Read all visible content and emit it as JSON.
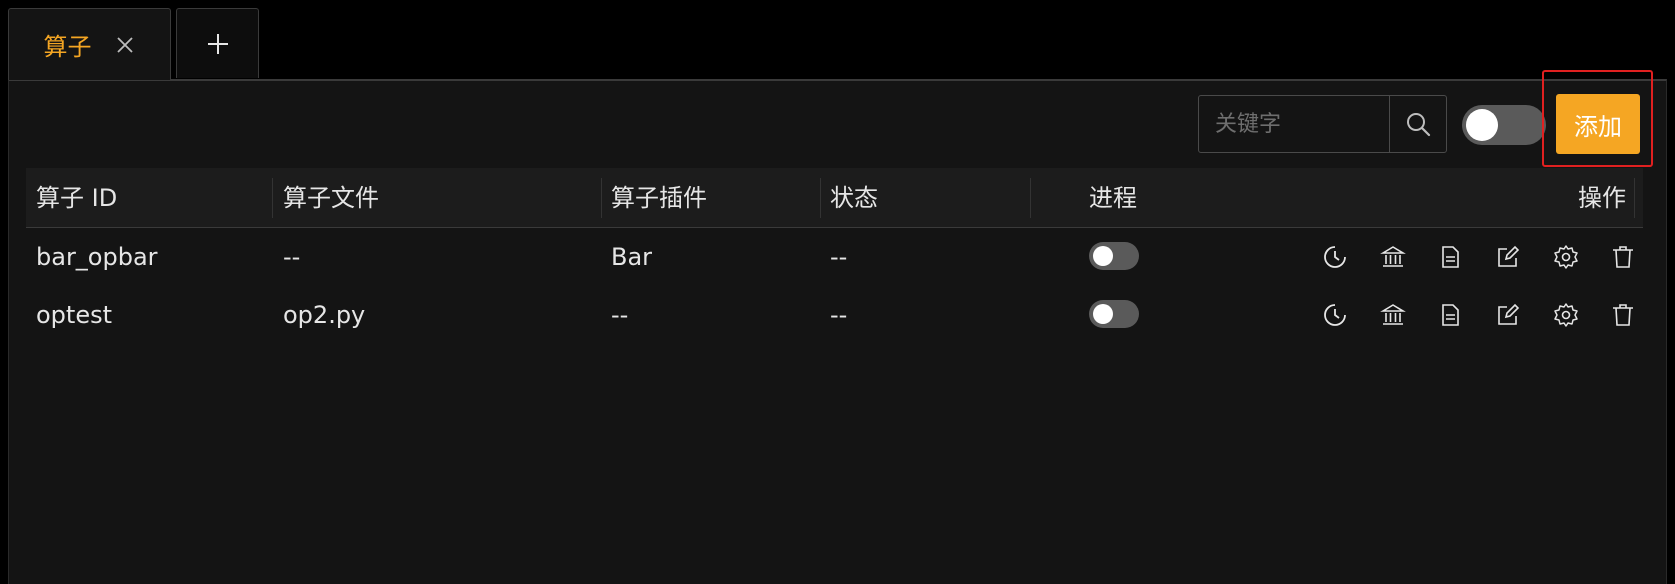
{
  "tabs": [
    {
      "label": "算子"
    }
  ],
  "toolbar": {
    "search_placeholder": "关键字",
    "add_label": "添加"
  },
  "table": {
    "columns": [
      "算子 ID",
      "算子文件",
      "算子插件",
      "状态",
      "进程",
      "操作"
    ],
    "rows": [
      {
        "id": "bar_opbar",
        "file": "--",
        "plugin": "Bar",
        "status": "--"
      },
      {
        "id": "optest",
        "file": "op2.py",
        "plugin": "--",
        "status": "--"
      }
    ]
  },
  "colors": {
    "accent": "#f5a623",
    "highlight": "#e02020"
  },
  "icons": [
    "clock-icon",
    "bank-icon",
    "document-icon",
    "edit-icon",
    "gear-icon",
    "trash-icon"
  ]
}
